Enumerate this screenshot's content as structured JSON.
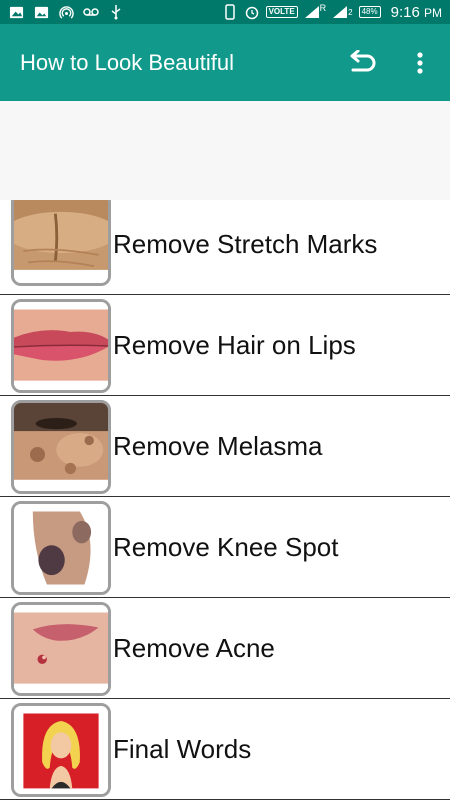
{
  "status_bar": {
    "volte": "VOLTE",
    "roaming": "R",
    "sim2": "2",
    "battery": "48%",
    "time": "9:16",
    "ampm": "PM"
  },
  "app_bar": {
    "title": "How to Look Beautiful",
    "back_icon": "undo-arrow-icon",
    "menu_icon": "more-vert-icon"
  },
  "list": {
    "items": [
      {
        "label": "Remove Stretch Marks",
        "thumb": "belly-stretch-marks-photo"
      },
      {
        "label": "Remove Hair on Lips",
        "thumb": "lips-photo"
      },
      {
        "label": "Remove Melasma",
        "thumb": "face-melasma-photo"
      },
      {
        "label": "Remove Knee Spot",
        "thumb": "knee-spot-photo"
      },
      {
        "label": "Remove Acne",
        "thumb": "acne-lips-photo"
      },
      {
        "label": "Final Words",
        "thumb": "blonde-woman-cartoon"
      }
    ]
  },
  "colors": {
    "status_bar": "#00796b",
    "app_bar": "#119a8b",
    "divider": "#333333",
    "thumb_border": "#9e9e9e"
  }
}
